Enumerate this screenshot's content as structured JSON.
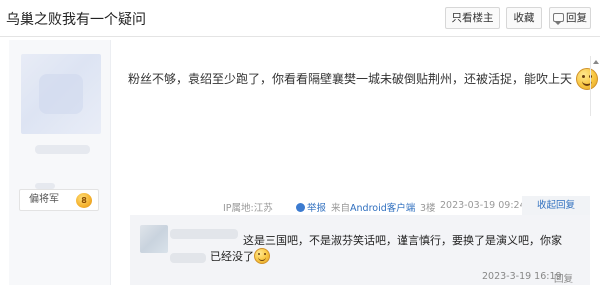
{
  "header": {
    "title": "乌巢之败我有一个疑问",
    "only_louzhu_label": "只看楼主",
    "favorite_label": "收藏",
    "reply_label": "回复"
  },
  "author": {
    "rank_label": "偏将军",
    "rank_level": "8"
  },
  "post": {
    "content": "粉丝不够，袁绍至少跑了，你看看隔壁襄樊一城未破倒贴荆州，还被活捉，能吹上天",
    "emoji": "smile-icon"
  },
  "meta": {
    "ip": "IP属地:江苏",
    "report_label": "举报",
    "client_prefix": "来自",
    "client_link": "Android客户端",
    "floor": "3楼",
    "time": "2023-03-19 09:24",
    "collapse_label": "收起回复"
  },
  "sub_reply": {
    "line1": "这是三国吧，不是淑芬笑话吧，谨言慎行，要换了是演义吧，你家",
    "line2": "已经没了",
    "time": "2023-3-19 16:19",
    "reply_label": "回复"
  },
  "colors": {
    "link": "#2f6fbf",
    "meta_gray": "#999999",
    "sub_bg": "#f3f4f7"
  }
}
